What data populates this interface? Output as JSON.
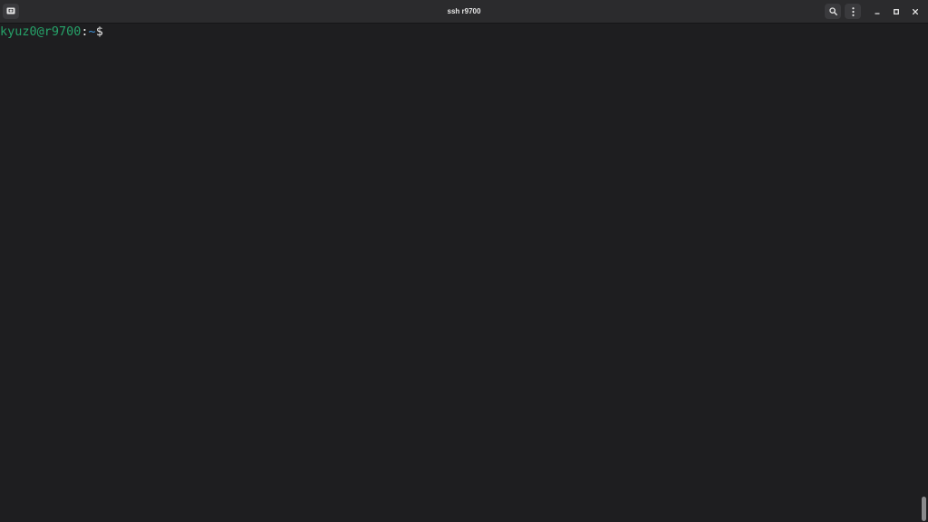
{
  "window": {
    "title": "ssh r9700"
  },
  "titlebar": {
    "icons": {
      "new_tab": "new-tab-icon",
      "search": "search-icon",
      "menu": "kebab-menu-icon",
      "minimize": "minimize-icon",
      "maximize": "maximize-icon",
      "close": "close-icon"
    }
  },
  "terminal": {
    "prompt": {
      "user_host": "kyuz0@r9700",
      "separator": ":",
      "path": "~",
      "symbol": "$"
    }
  },
  "colors": {
    "background": "#1e1e20",
    "titlebar": "#2b2b2d",
    "prompt_user_host": "#26a269",
    "prompt_path": "#3d8fd4"
  }
}
